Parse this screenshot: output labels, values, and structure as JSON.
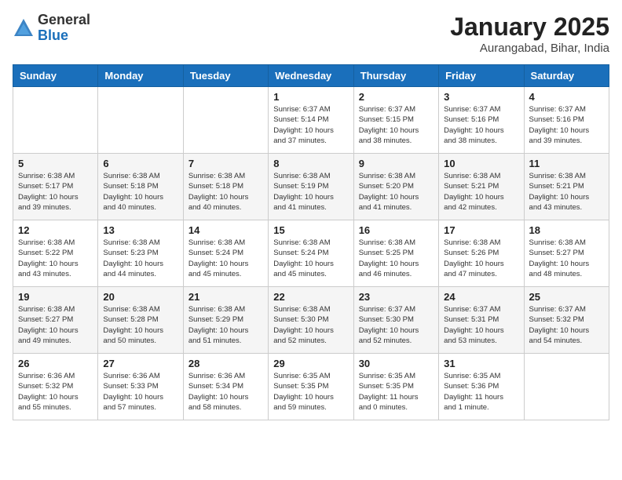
{
  "header": {
    "logo_general": "General",
    "logo_blue": "Blue",
    "month_title": "January 2025",
    "location": "Aurangabad, Bihar, India"
  },
  "weekdays": [
    "Sunday",
    "Monday",
    "Tuesday",
    "Wednesday",
    "Thursday",
    "Friday",
    "Saturday"
  ],
  "weeks": [
    [
      {
        "day": "",
        "info": ""
      },
      {
        "day": "",
        "info": ""
      },
      {
        "day": "",
        "info": ""
      },
      {
        "day": "1",
        "info": "Sunrise: 6:37 AM\nSunset: 5:14 PM\nDaylight: 10 hours\nand 37 minutes."
      },
      {
        "day": "2",
        "info": "Sunrise: 6:37 AM\nSunset: 5:15 PM\nDaylight: 10 hours\nand 38 minutes."
      },
      {
        "day": "3",
        "info": "Sunrise: 6:37 AM\nSunset: 5:16 PM\nDaylight: 10 hours\nand 38 minutes."
      },
      {
        "day": "4",
        "info": "Sunrise: 6:37 AM\nSunset: 5:16 PM\nDaylight: 10 hours\nand 39 minutes."
      }
    ],
    [
      {
        "day": "5",
        "info": "Sunrise: 6:38 AM\nSunset: 5:17 PM\nDaylight: 10 hours\nand 39 minutes."
      },
      {
        "day": "6",
        "info": "Sunrise: 6:38 AM\nSunset: 5:18 PM\nDaylight: 10 hours\nand 40 minutes."
      },
      {
        "day": "7",
        "info": "Sunrise: 6:38 AM\nSunset: 5:18 PM\nDaylight: 10 hours\nand 40 minutes."
      },
      {
        "day": "8",
        "info": "Sunrise: 6:38 AM\nSunset: 5:19 PM\nDaylight: 10 hours\nand 41 minutes."
      },
      {
        "day": "9",
        "info": "Sunrise: 6:38 AM\nSunset: 5:20 PM\nDaylight: 10 hours\nand 41 minutes."
      },
      {
        "day": "10",
        "info": "Sunrise: 6:38 AM\nSunset: 5:21 PM\nDaylight: 10 hours\nand 42 minutes."
      },
      {
        "day": "11",
        "info": "Sunrise: 6:38 AM\nSunset: 5:21 PM\nDaylight: 10 hours\nand 43 minutes."
      }
    ],
    [
      {
        "day": "12",
        "info": "Sunrise: 6:38 AM\nSunset: 5:22 PM\nDaylight: 10 hours\nand 43 minutes."
      },
      {
        "day": "13",
        "info": "Sunrise: 6:38 AM\nSunset: 5:23 PM\nDaylight: 10 hours\nand 44 minutes."
      },
      {
        "day": "14",
        "info": "Sunrise: 6:38 AM\nSunset: 5:24 PM\nDaylight: 10 hours\nand 45 minutes."
      },
      {
        "day": "15",
        "info": "Sunrise: 6:38 AM\nSunset: 5:24 PM\nDaylight: 10 hours\nand 45 minutes."
      },
      {
        "day": "16",
        "info": "Sunrise: 6:38 AM\nSunset: 5:25 PM\nDaylight: 10 hours\nand 46 minutes."
      },
      {
        "day": "17",
        "info": "Sunrise: 6:38 AM\nSunset: 5:26 PM\nDaylight: 10 hours\nand 47 minutes."
      },
      {
        "day": "18",
        "info": "Sunrise: 6:38 AM\nSunset: 5:27 PM\nDaylight: 10 hours\nand 48 minutes."
      }
    ],
    [
      {
        "day": "19",
        "info": "Sunrise: 6:38 AM\nSunset: 5:27 PM\nDaylight: 10 hours\nand 49 minutes."
      },
      {
        "day": "20",
        "info": "Sunrise: 6:38 AM\nSunset: 5:28 PM\nDaylight: 10 hours\nand 50 minutes."
      },
      {
        "day": "21",
        "info": "Sunrise: 6:38 AM\nSunset: 5:29 PM\nDaylight: 10 hours\nand 51 minutes."
      },
      {
        "day": "22",
        "info": "Sunrise: 6:38 AM\nSunset: 5:30 PM\nDaylight: 10 hours\nand 52 minutes."
      },
      {
        "day": "23",
        "info": "Sunrise: 6:37 AM\nSunset: 5:30 PM\nDaylight: 10 hours\nand 52 minutes."
      },
      {
        "day": "24",
        "info": "Sunrise: 6:37 AM\nSunset: 5:31 PM\nDaylight: 10 hours\nand 53 minutes."
      },
      {
        "day": "25",
        "info": "Sunrise: 6:37 AM\nSunset: 5:32 PM\nDaylight: 10 hours\nand 54 minutes."
      }
    ],
    [
      {
        "day": "26",
        "info": "Sunrise: 6:36 AM\nSunset: 5:32 PM\nDaylight: 10 hours\nand 55 minutes."
      },
      {
        "day": "27",
        "info": "Sunrise: 6:36 AM\nSunset: 5:33 PM\nDaylight: 10 hours\nand 57 minutes."
      },
      {
        "day": "28",
        "info": "Sunrise: 6:36 AM\nSunset: 5:34 PM\nDaylight: 10 hours\nand 58 minutes."
      },
      {
        "day": "29",
        "info": "Sunrise: 6:35 AM\nSunset: 5:35 PM\nDaylight: 10 hours\nand 59 minutes."
      },
      {
        "day": "30",
        "info": "Sunrise: 6:35 AM\nSunset: 5:35 PM\nDaylight: 11 hours\nand 0 minutes."
      },
      {
        "day": "31",
        "info": "Sunrise: 6:35 AM\nSunset: 5:36 PM\nDaylight: 11 hours\nand 1 minute."
      },
      {
        "day": "",
        "info": ""
      }
    ]
  ]
}
